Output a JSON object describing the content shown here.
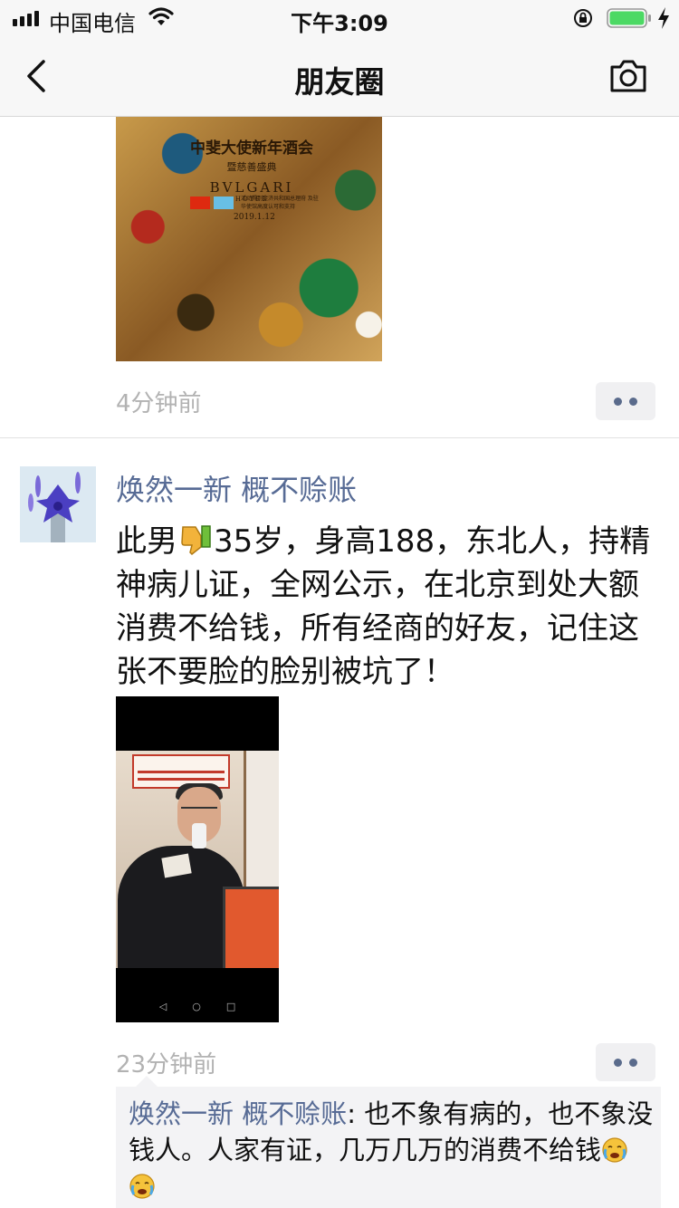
{
  "status_bar": {
    "carrier": "中国电信",
    "time": "下午3:09"
  },
  "nav": {
    "title": "朋友圈"
  },
  "post1": {
    "poster": {
      "title": "中斐大使新年酒会",
      "subtitle": "暨慈善盛典",
      "brand": "BVLGARI",
      "brand_sub": "HOTEL",
      "note": "活动得到斐济共和国总理府 及驻华使馆高度认可和支持",
      "date": "2019.1.12"
    },
    "timestamp": "4分钟前"
  },
  "post2": {
    "author": "焕然一新 概不赊账",
    "text_before_emoji": "此男",
    "text_after_emoji": "35岁，身高188，东北人，持精神病儿证，全网公示，在北京到处大额消费不给钱，所有经商的好友，记住这张不要脸的脸别被坑了！",
    "timestamp": "23分钟前",
    "comment": {
      "author": "焕然一新 概不赊账",
      "separator": ": ",
      "text": "也不象有病的，也不象没钱人。人家有证，几万几万的消费不给钱"
    }
  }
}
